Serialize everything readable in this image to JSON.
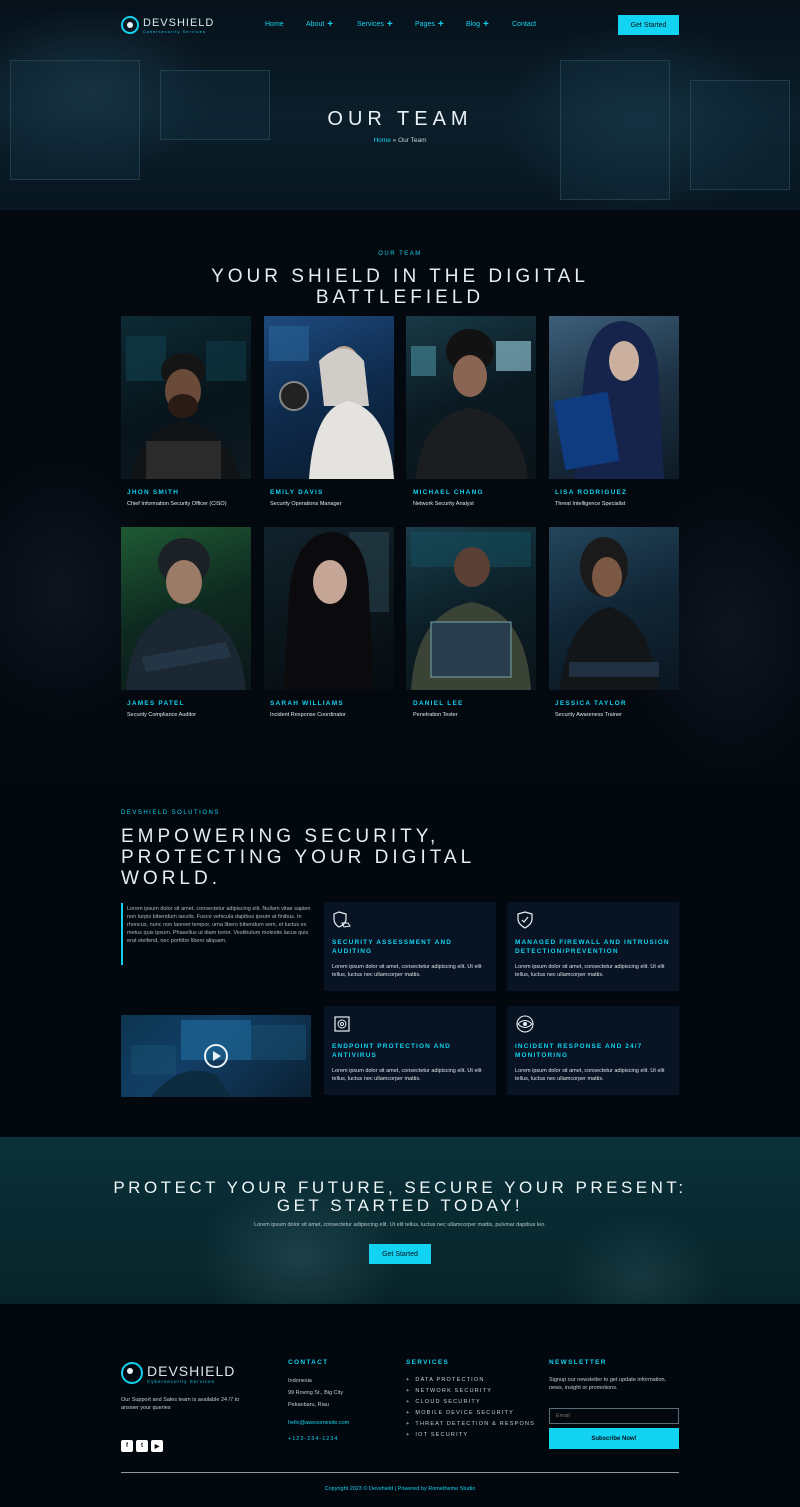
{
  "brand": {
    "name": "DEVSHIELD",
    "tagline": "Cybersecurity Services"
  },
  "nav": {
    "items": [
      {
        "label": "Home",
        "has_submenu": false
      },
      {
        "label": "About",
        "has_submenu": true
      },
      {
        "label": "Services",
        "has_submenu": true
      },
      {
        "label": "Pages",
        "has_submenu": true
      },
      {
        "label": "Blog",
        "has_submenu": true
      },
      {
        "label": "Contact",
        "has_submenu": false
      }
    ],
    "cta_label": "Get Started"
  },
  "hero": {
    "title": "OUR TEAM",
    "breadcrumb": {
      "home": "Home",
      "separator": "»",
      "current": "Our Team"
    }
  },
  "team": {
    "eyebrow": "OUR TEAM",
    "heading_line1": "YOUR SHIELD IN THE DIGITAL",
    "heading_line2": "BATTLEFIELD",
    "members": [
      {
        "name": "JHON SMITH",
        "role": "Chief Information Security Officer (CISO)"
      },
      {
        "name": "EMILY DAVIS",
        "role": "Security Operations Manager"
      },
      {
        "name": "MICHAEL CHANG",
        "role": "Network Security Analyst"
      },
      {
        "name": "LISA RODRIGUEZ",
        "role": "Threat Intelligence Specialist"
      },
      {
        "name": "JAMES PATEL",
        "role": "Security Compliance Auditor"
      },
      {
        "name": "SARAH WILLIAMS",
        "role": "Incident Response Coordinator"
      },
      {
        "name": "DANIEL LEE",
        "role": "Penetration Tester"
      },
      {
        "name": "JESSICA TAYLOR",
        "role": "Security Awareness Trainer"
      }
    ]
  },
  "solutions": {
    "eyebrow": "DEVSHIELD SOLUTIONS",
    "heading_line1": "EMPOWERING SECURITY,",
    "heading_line2": "PROTECTING YOUR DIGITAL",
    "heading_line3": "WORLD.",
    "intro": "Lorem ipsum dolor sit amet, consectetur adipiscing elit. Nullam vitae sapien non turpis bibendum iaculis. Fusce vehicula dapibus ipsum at finibus. In rhoncus, nunc non laoreet tempor, urna libero bibendum sem, et luctus ex metus quis ipsum. Phasellus ut diam tortor. Vestibulum molestie lacus quis erat eleifend, nec porttitor libero aliquam.",
    "services": [
      {
        "title": "SECURITY ASSESSMENT AND AUDITING",
        "text": "Lorem ipsum dolor sit amet, consectetur adipiscing elit. Ut elit tellus, luctus nec ullamcorper mattis.",
        "icon": "shield-hand-icon"
      },
      {
        "title": "MANAGED FIREWALL AND INTRUSION DETECTION/PREVENTION",
        "text": "Lorem ipsum dolor sit amet, consectetur adipiscing elit. Ut elit tellus, luctus nec ullamcorper mattis.",
        "icon": "shield-check-icon"
      },
      {
        "title": "ENDPOINT PROTECTION AND ANTIVIRUS",
        "text": "Lorem ipsum dolor sit amet, consectetur adipiscing elit. Ut elit tellus, luctus nec ullamcorper mattis.",
        "icon": "fingerprint-chip-icon"
      },
      {
        "title": "INCIDENT RESPONSE AND 24/7 MONITORING",
        "text": "Lorem ipsum dolor sit amet, consectetur adipiscing elit. Ut elit tellus, luctus nec ullamcorper mattis.",
        "icon": "eye-monitoring-icon"
      }
    ]
  },
  "cta": {
    "heading_line1": "PROTECT YOUR FUTURE, SECURE YOUR PRESENT:",
    "heading_line2": "GET STARTED TODAY!",
    "text": "Lorem ipsum dolor sit amet, consectetur adipiscing elit. Ut elit tellus, luctus nec ullamcorper mattis, pulvinar dapibus leo.",
    "button": "Get Started"
  },
  "footer": {
    "about": "Our Support and Sales team is available 24 /7 to answer your queries",
    "contact": {
      "heading": "CONTACT",
      "country": "Indonesia",
      "street": "99 Roving St., Big City",
      "city": "Pekanbaru, Riau",
      "email": "hello@awesomesite.com",
      "phone": "+123-234-1234"
    },
    "services": {
      "heading": "SERVICES",
      "items": [
        "DATA PROTECTION",
        "NETWORK SECURITY",
        "CLOUD SECURITY",
        "MOBILE DEVICE SECURITY",
        "THREAT DETECTION & RESPONS",
        "IOT SECURITY"
      ]
    },
    "newsletter": {
      "heading": "NEWSLETTER",
      "text": "Signup our newsletter to get update information, news, insight or promotions.",
      "placeholder": "Email",
      "button": "Subscribe Now!"
    },
    "copyright": "Copyright 2023 © Devshield | Powered by Rometheme Studio"
  },
  "colors": {
    "accent": "#12d4f2",
    "background": "#03070e",
    "card": "#081424",
    "cta_band": "#0a2e35"
  }
}
